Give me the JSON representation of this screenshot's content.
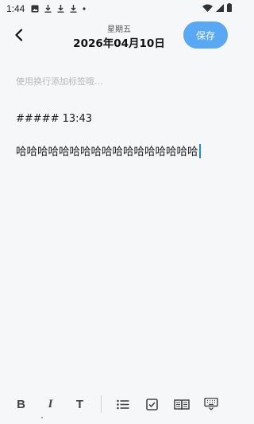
{
  "status_bar": {
    "time": "1:44",
    "icons": [
      "image-icon",
      "download-icon",
      "download-icon",
      "download-icon",
      "dot-icon",
      "wifi-icon",
      "signal-icon",
      "battery-icon"
    ]
  },
  "header": {
    "weekday": "星期五",
    "date": "2026年04月10日",
    "save_label": "保存"
  },
  "tags": {
    "placeholder": "使用换行添加标签哦..."
  },
  "editor": {
    "heading_line": "##### 13:43",
    "body_text": "哈哈哈哈哈哈哈哈哈哈哈哈哈哈哈哈哈"
  },
  "toolbar": {
    "bold": "B",
    "italic": "I",
    "text": "T"
  },
  "colors": {
    "accent": "#58a8f3",
    "background": "#f6f7f9",
    "caret": "#1e88e5"
  }
}
